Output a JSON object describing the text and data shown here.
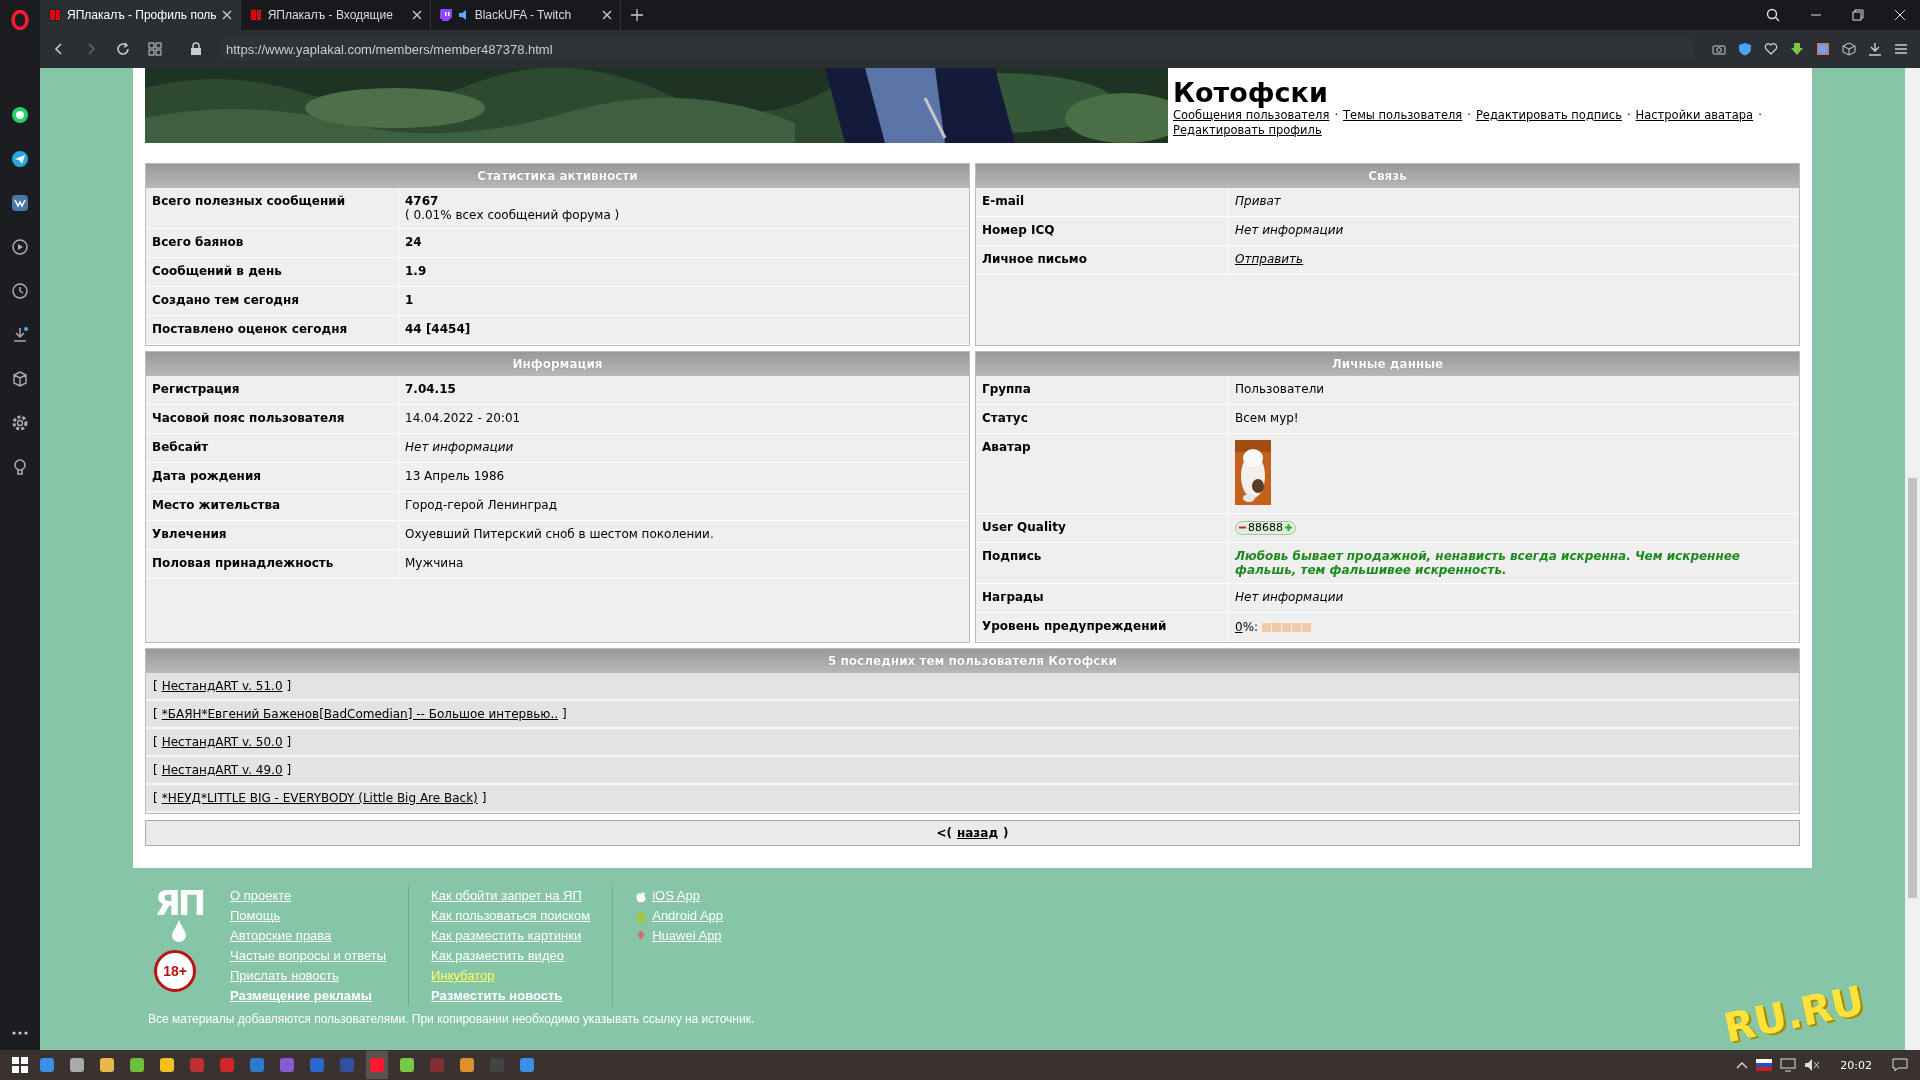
{
  "browser": {
    "tabs": [
      {
        "title": "ЯПлакалъ - Профиль поль",
        "selected": true,
        "kind": "yp"
      },
      {
        "title": "ЯПлакалъ - Входящие",
        "selected": false,
        "kind": "yp"
      },
      {
        "title": "BlackUFA - Twitch",
        "selected": false,
        "kind": "twitch"
      }
    ],
    "url": "https://www.yaplakal.com/members/member487378.html"
  },
  "profile": {
    "name": "Котофски",
    "links": [
      "Сообщения пользователя",
      "Темы пользователя",
      "Редактировать подпись",
      "Настройки аватара",
      "Редактировать профиль"
    ],
    "separator": "·"
  },
  "panels": [
    {
      "title": "Статистика активности",
      "rows": [
        {
          "label": "Всего полезных сообщений",
          "value": "4767",
          "note": "( 0.01% всех сообщений форума )",
          "kind": "bold"
        },
        {
          "label": "Всего баянов",
          "value": "24",
          "kind": "bold"
        },
        {
          "label": "Сообщений в день",
          "value": "1.9",
          "kind": "bold"
        },
        {
          "label": "Создано тем сегодня",
          "value": "1",
          "kind": "bold"
        },
        {
          "label": "Поставлено оценок сегодня",
          "value": "44 [4454]",
          "kind": "bold"
        }
      ]
    },
    {
      "title": "Связь",
      "rows": [
        {
          "label": "E-mail",
          "value": "Приват",
          "kind": "italic"
        },
        {
          "label": "Номер ICQ",
          "value": "Нет информации",
          "kind": "italic"
        },
        {
          "label": "Личное письмо",
          "value": "Отправить",
          "kind": "link"
        }
      ]
    },
    {
      "title": "Информация",
      "rows": [
        {
          "label": "Регистрация",
          "value": "7.04.15",
          "kind": "bold"
        },
        {
          "label": "Часовой пояс пользователя",
          "value": "14.04.2022 - 20:01",
          "kind": "plain"
        },
        {
          "label": "Вебсайт",
          "value": "Нет информации",
          "kind": "italic"
        },
        {
          "label": "Дата рождения",
          "value": "13 Апрель 1986",
          "kind": "plain"
        },
        {
          "label": "Место жительства",
          "value": "Город-герой Ленинград",
          "kind": "plain"
        },
        {
          "label": "Увлечения",
          "value": "Охуевший Питерский сноб в шестом поколении.",
          "kind": "plain"
        },
        {
          "label": "Половая принадлежность",
          "value": "Мужчина",
          "kind": "plain"
        }
      ]
    },
    {
      "title": "Личные данные",
      "rows": [
        {
          "label": "Группа",
          "value": "Пользователи",
          "kind": "plain"
        },
        {
          "label": "Статус",
          "value": "Всем мур!",
          "kind": "plain"
        },
        {
          "label": "Аватар",
          "kind": "avatar"
        },
        {
          "label": "User Quality",
          "value": "88688",
          "kind": "rating"
        },
        {
          "label": "Подпись",
          "value": "Любовь бывает продажной, ненависть всегда искренна. Чем искреннее фальшь, тем фальшивее искренность.",
          "kind": "signature"
        },
        {
          "label": "Награды",
          "value": "Нет информации",
          "kind": "italic"
        },
        {
          "label": "Уровень предупреждений",
          "value": "0",
          "suffix": "%:",
          "kind": "warning"
        }
      ]
    }
  ],
  "topics": {
    "title": "5 последних тем пользователя Котофски",
    "open": "[",
    "close": "]",
    "items": [
      "НестандART v. 51.0",
      "*БАЯН*Евгений Баженов[BadComedian] -- Большое интервью..",
      "НестандART v. 50.0",
      "НестандART v. 49.0",
      "*НЕУД*LITTLE BIG - EVERYBODY (Little Big Are Back)"
    ]
  },
  "back": {
    "before": "<(",
    "link": "назад",
    "after": ")"
  },
  "footer": {
    "logo": "ЯП",
    "age": "18+",
    "columns": [
      [
        {
          "text": "О проекте",
          "kind": "normal"
        },
        {
          "text": "Помощь",
          "kind": "normal"
        },
        {
          "text": "Авторские права",
          "kind": "normal"
        },
        {
          "text": "Частые вопросы и ответы",
          "kind": "normal"
        },
        {
          "text": "Прислать новость",
          "kind": "normal"
        },
        {
          "text": "Размещение рекламы",
          "kind": "bold"
        }
      ],
      [
        {
          "text": "Как обойти запрет на ЯП",
          "kind": "normal"
        },
        {
          "text": "Как пользоваться поиском",
          "kind": "normal"
        },
        {
          "text": "Как разместить картинки",
          "kind": "normal"
        },
        {
          "text": "Как разместить видео",
          "kind": "normal"
        },
        {
          "text": "Инкубатор",
          "kind": "highlight"
        },
        {
          "text": "Разместить новость",
          "kind": "bold"
        }
      ],
      [
        {
          "text": "iOS App",
          "kind": "apple"
        },
        {
          "text": "Android App",
          "kind": "android"
        },
        {
          "text": "Huawei App",
          "kind": "huawei"
        }
      ]
    ],
    "notice": "Все материалы добавляются пользователями. При копировании необходимо указывать ссылку на источник.",
    "badge": "RU.RU"
  },
  "taskbar": {
    "time": "20:02"
  }
}
